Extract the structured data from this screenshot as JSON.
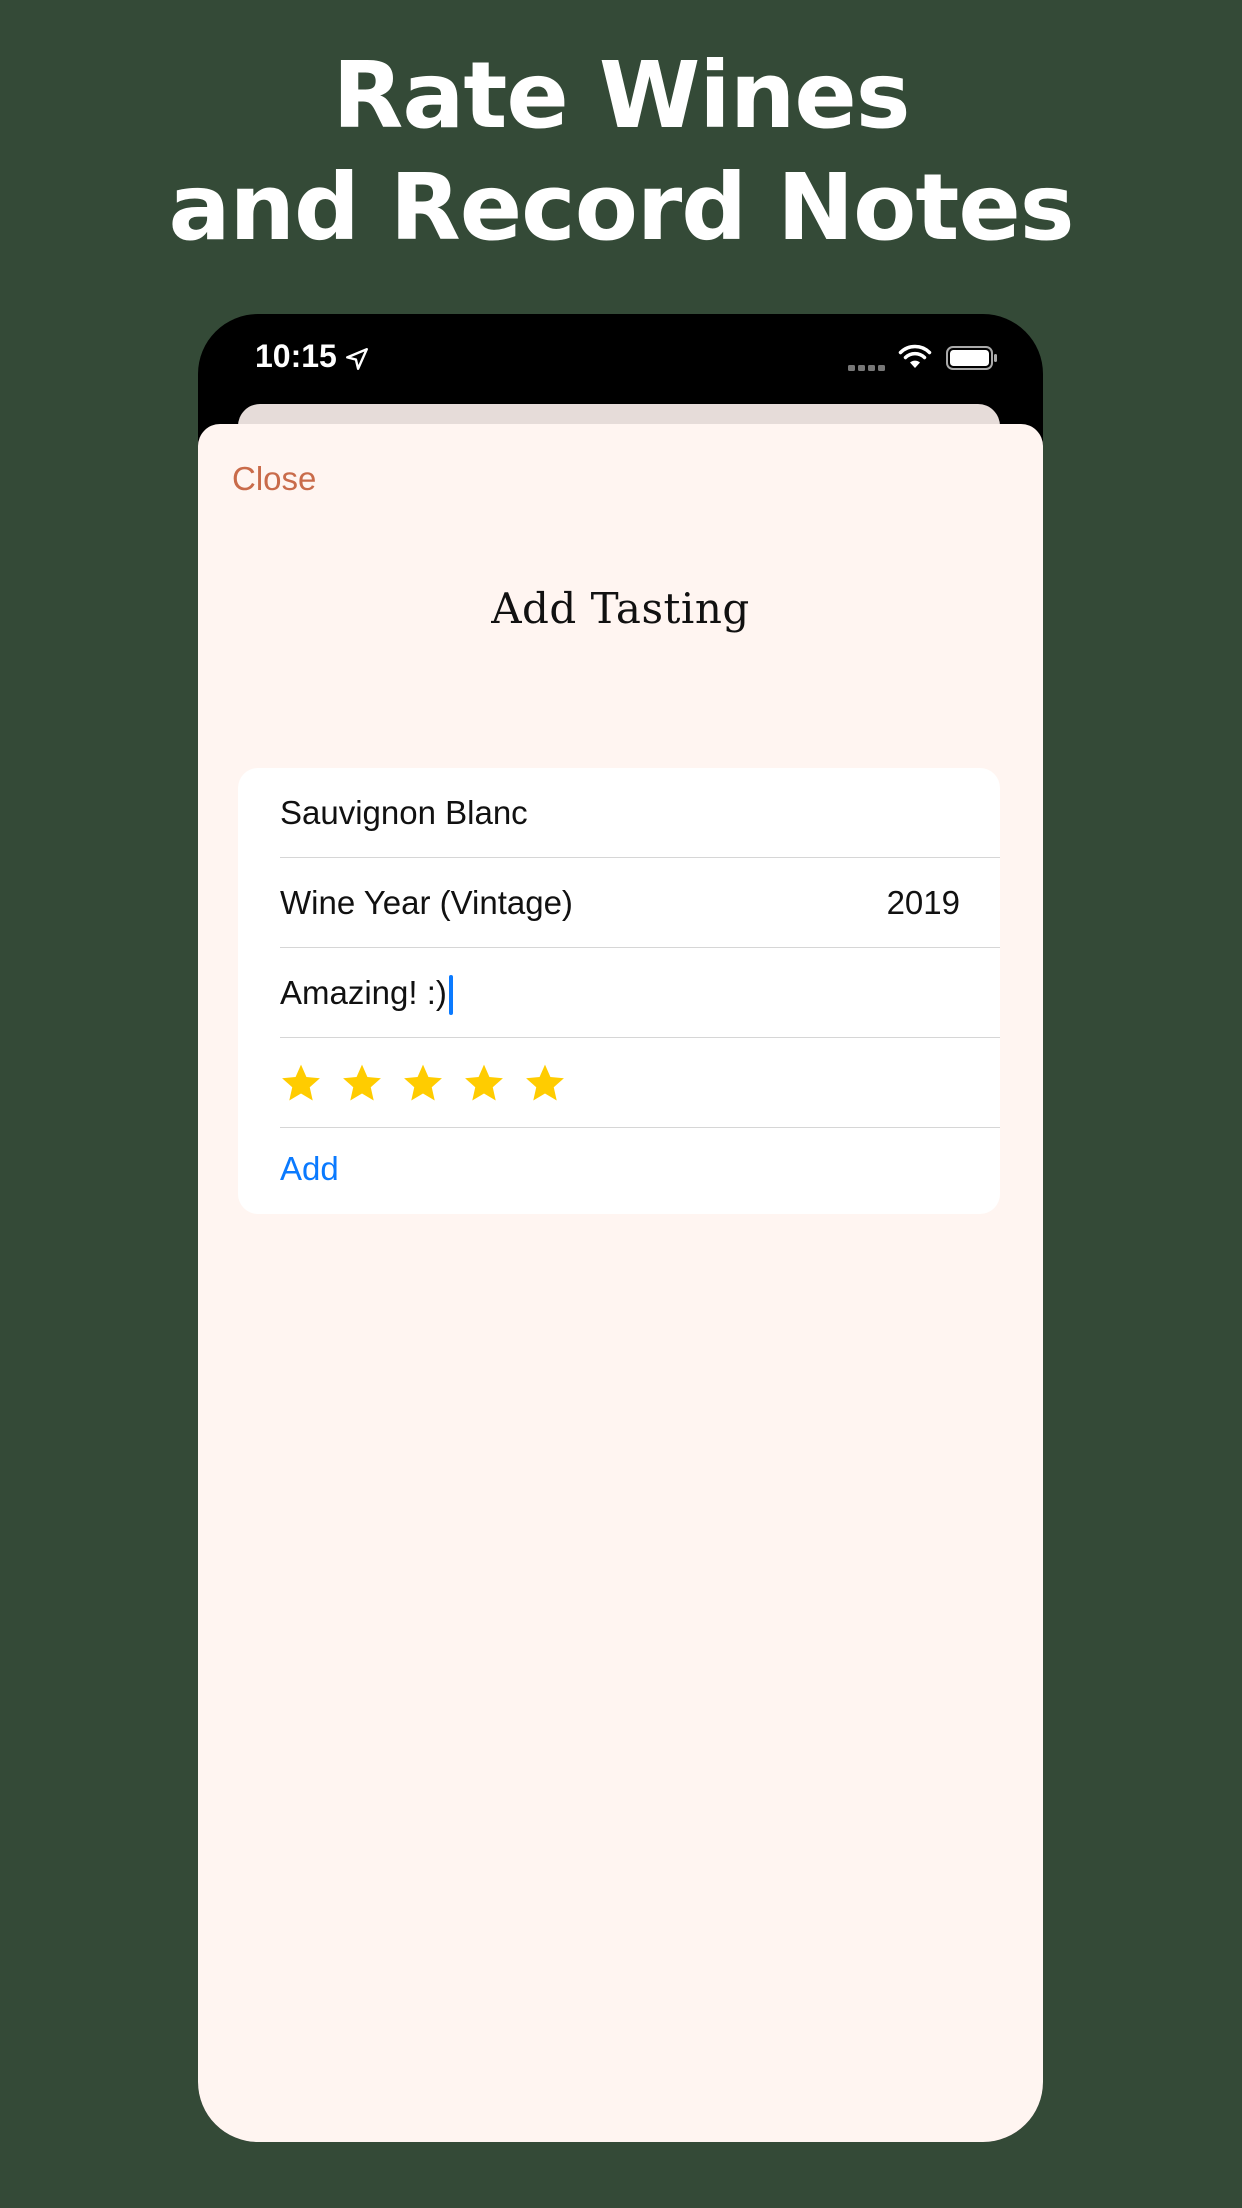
{
  "headline": {
    "line1": "Rate Wines",
    "line2": "and Record Notes"
  },
  "status_bar": {
    "time": "10:15"
  },
  "sheet": {
    "close_label": "Close",
    "title": "Add Tasting"
  },
  "form": {
    "wine_name": "Sauvignon Blanc",
    "vintage_label": "Wine Year (Vintage)",
    "vintage_value": "2019",
    "notes_value": "Amazing! :)",
    "rating": 5,
    "rating_max": 5,
    "add_label": "Add"
  },
  "colors": {
    "background": "#344a37",
    "sheet": "#fff5f1",
    "accent_close": "#c96b4a",
    "accent_add": "#0a7aff",
    "star": "#ffcc00"
  }
}
